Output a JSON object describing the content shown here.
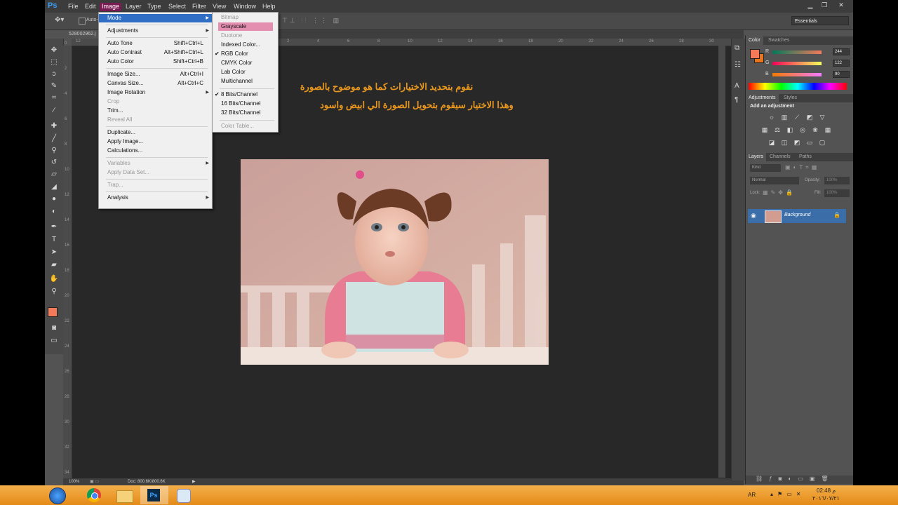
{
  "menubar": {
    "items": [
      "File",
      "Edit",
      "Image",
      "Layer",
      "Type",
      "Select",
      "Filter",
      "View",
      "Window",
      "Help"
    ],
    "active": "Image",
    "logo": "Ps"
  },
  "optbar": {
    "auto_label": "Auto-",
    "workspace": "Essentials"
  },
  "document": {
    "tab": "528002962.j",
    "status_zoom": "100%",
    "status_doc": "Doc: 800.6K/800.6K"
  },
  "canvas": {
    "line1": "نقوم بتحديد الاختيارات كما هو موضوح بالصورة",
    "line2": "وهذا الاختيار سيقوم بتحويل الصورة الي ابيض واسود"
  },
  "ruler": {
    "top": [
      "12",
      "",
      "10",
      "",
      "8",
      "",
      "6",
      "",
      "4",
      "",
      "2",
      "",
      "0",
      "",
      "2",
      "",
      "4",
      "",
      "6",
      "",
      "8",
      "",
      "10",
      "",
      "12",
      "",
      "14",
      "",
      "16",
      "",
      "18",
      "",
      "20",
      "",
      "22",
      "",
      "24",
      "",
      "26",
      "",
      "28",
      "",
      "30",
      "",
      "32",
      "",
      "34"
    ],
    "left": [
      "0",
      "2",
      "4",
      "6",
      "8",
      "10",
      "12",
      "14",
      "16",
      "18",
      "20",
      "22",
      "24",
      "26",
      "28",
      "30",
      "32",
      "34"
    ]
  },
  "image_menu": {
    "items": [
      {
        "label": "Mode",
        "shortcut": "",
        "submenu": true,
        "highlight": true
      },
      {
        "sep": true
      },
      {
        "label": "Adjustments",
        "shortcut": "",
        "submenu": true
      },
      {
        "sep": true
      },
      {
        "label": "Auto Tone",
        "shortcut": "Shift+Ctrl+L"
      },
      {
        "label": "Auto Contrast",
        "shortcut": "Alt+Shift+Ctrl+L"
      },
      {
        "label": "Auto Color",
        "shortcut": "Shift+Ctrl+B"
      },
      {
        "sep": true
      },
      {
        "label": "Image Size...",
        "shortcut": "Alt+Ctrl+I"
      },
      {
        "label": "Canvas Size...",
        "shortcut": "Alt+Ctrl+C"
      },
      {
        "label": "Image Rotation",
        "shortcut": "",
        "submenu": true
      },
      {
        "label": "Crop",
        "shortcut": "",
        "disabled": true
      },
      {
        "label": "Trim...",
        "shortcut": ""
      },
      {
        "label": "Reveal All",
        "shortcut": "",
        "disabled": true
      },
      {
        "sep": true
      },
      {
        "label": "Duplicate...",
        "shortcut": ""
      },
      {
        "label": "Apply Image...",
        "shortcut": ""
      },
      {
        "label": "Calculations...",
        "shortcut": ""
      },
      {
        "sep": true
      },
      {
        "label": "Variables",
        "shortcut": "",
        "submenu": true,
        "disabled": true
      },
      {
        "label": "Apply Data Set...",
        "shortcut": "",
        "disabled": true
      },
      {
        "sep": true
      },
      {
        "label": "Trap...",
        "shortcut": "",
        "disabled": true
      },
      {
        "sep": true
      },
      {
        "label": "Analysis",
        "shortcut": "",
        "submenu": true
      }
    ]
  },
  "mode_menu": {
    "items": [
      {
        "label": "Bitmap",
        "disabled": true
      },
      {
        "label": "Grayscale",
        "highlight": true
      },
      {
        "label": "Duotone",
        "disabled": true
      },
      {
        "label": "Indexed Color..."
      },
      {
        "label": "RGB Color",
        "checked": true
      },
      {
        "label": "CMYK Color"
      },
      {
        "label": "Lab Color"
      },
      {
        "label": "Multichannel"
      },
      {
        "sep": true
      },
      {
        "label": "8 Bits/Channel",
        "checked": true
      },
      {
        "label": "16 Bits/Channel"
      },
      {
        "label": "32 Bits/Channel"
      },
      {
        "sep": true
      },
      {
        "label": "Color Table...",
        "disabled": true
      }
    ]
  },
  "color_panel": {
    "tabs": [
      "Color",
      "Swatches"
    ],
    "r_label": "R",
    "g_label": "G",
    "b_label": "B",
    "r": "244",
    "g": "122",
    "b": "90",
    "fg_color": "#f47a5a",
    "bg_color": "#e8741e"
  },
  "adjust_panel": {
    "tabs": [
      "Adjustments",
      "Styles"
    ],
    "heading": "Add an adjustment"
  },
  "layers_panel": {
    "tabs": [
      "Layers",
      "Channels",
      "Paths"
    ],
    "kind": "Kind",
    "blend": "Normal",
    "opacity_label": "Opacity:",
    "opacity": "100%",
    "lock_label": "Lock:",
    "fill_label": "Fill:",
    "fill": "100%",
    "layer_name": "Background"
  },
  "taskbar": {
    "lang": "AR",
    "time": "02:48 م",
    "date": "٢٠١٦/٠٧/٢١"
  }
}
